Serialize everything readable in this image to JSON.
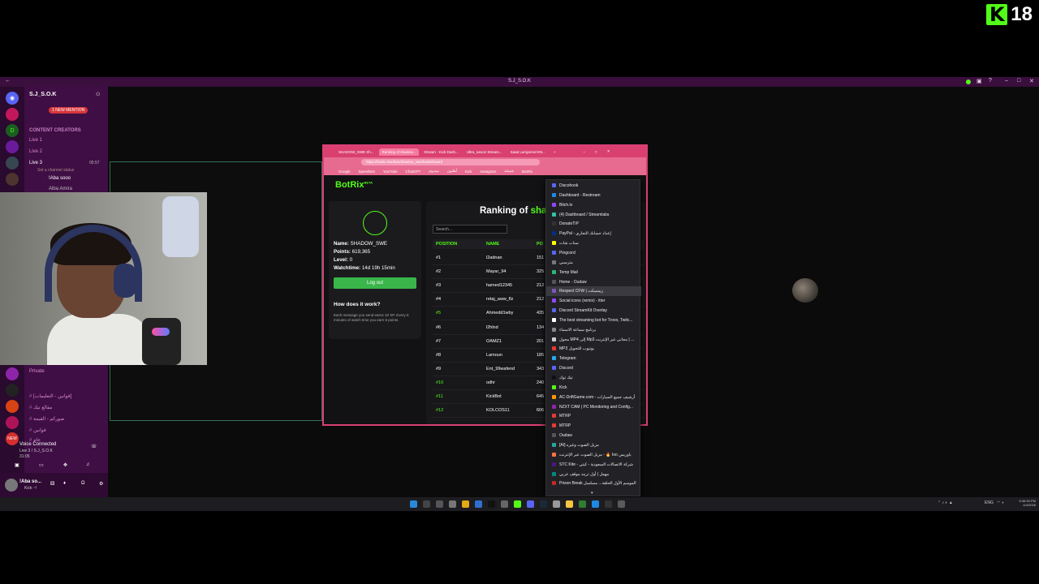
{
  "rating": {
    "logo_letter": "K",
    "age": "18"
  },
  "window": {
    "title": "S.J_S.O.K"
  },
  "discord": {
    "server_name": "S.J_S.O.K",
    "new_mention": "1 NEW MENTION",
    "category_creators": "CONTENT CREATORS",
    "channels": [
      {
        "label": "Live 1"
      },
      {
        "label": "Live 2"
      },
      {
        "label": "Live 3",
        "time": "05:57"
      },
      {
        "label": "Set a channel status"
      },
      {
        "label": "!Aba sooo"
      },
      {
        "label": "Alba Amira"
      },
      {
        "label": "Private"
      },
      {
        "label": "[قوانين - التعليمات]"
      },
      {
        "label": "مقالع تيك"
      },
      {
        "label": "صوركم - القيمة"
      },
      {
        "label": "قوانين"
      },
      {
        "label": "عام"
      }
    ],
    "voice_status": "Voice Connected",
    "voice_channel": "Live 3 / S.J_S.O.K",
    "voice_time": "31:05",
    "user": {
      "name": "!Aba so...",
      "status": "Kick ~!"
    }
  },
  "browser": {
    "tabs": [
      {
        "label": "SHADOW_SWE Sh..."
      },
      {
        "label": "Ranking of shadow..."
      },
      {
        "label": "Stream - Kick Dash..."
      },
      {
        "label": "Ultra_sano2 Stream..."
      },
      {
        "label": "Saad Lamjarred EN..."
      }
    ],
    "url": "https://botrix.live/kick/shadow_swe/leaderboard",
    "bookmarks": [
      "Google",
      "Speedtest",
      "YouTube",
      "ChatGPT",
      "ميديوم",
      "أهلنون",
      "Kick",
      "Instagram",
      "شيشة",
      "BotRix"
    ],
    "app": {
      "logo": "BotRix",
      "logo_badge": "BETA",
      "user": {
        "name_label": "Name:",
        "name": "SHADOW_SWE",
        "points_label": "Points:",
        "points": "619,365",
        "level_label": "Level:",
        "level": "0",
        "watch_label": "Watchtime:",
        "watchtime": "14d 19h 15min"
      },
      "logout": "Log out",
      "how_title": "How does it work?",
      "how_text": "Each message you send earns 10 XP. Every 6 minutes of watch time you earn 6 points.",
      "rank_title_prefix": "Ranking of ",
      "rank_title_name": "sha",
      "search_placeholder": "Search...",
      "columns": {
        "position": "POSITION",
        "name": "NAME",
        "points": "PO"
      },
      "rows": [
        {
          "pos": "#1",
          "name": "l2adnan",
          "pts": "151"
        },
        {
          "pos": "#2",
          "name": "Mayar_94",
          "pts": "325"
        },
        {
          "pos": "#3",
          "name": "hamed12345",
          "pts": "212"
        },
        {
          "pos": "#4",
          "name": "retaj_aww_flz",
          "pts": "212"
        },
        {
          "pos": "#5",
          "name": "Ahmedd1wby",
          "pts": "435"
        },
        {
          "pos": "#6",
          "name": "l2hlnd",
          "pts": "134"
        },
        {
          "pos": "#7",
          "name": "OAMZ1",
          "pts": "201"
        },
        {
          "pos": "#8",
          "name": "Lamoun",
          "pts": "185"
        },
        {
          "pos": "#9",
          "name": "Ent_99wafend",
          "pts": "343"
        },
        {
          "pos": "#10",
          "name": "odhr",
          "pts": "240"
        },
        {
          "pos": "#11",
          "name": "KickBot",
          "pts": "645"
        },
        {
          "pos": "#12",
          "name": "KOLCOS11",
          "pts": "606"
        }
      ]
    }
  },
  "bookmark_menu": {
    "items": [
      {
        "label": "Discohook",
        "color": "#5865f2"
      },
      {
        "label": "Dashboard - Restream",
        "color": "#1e88e5"
      },
      {
        "label": "Bitch.tv",
        "color": "#9146ff"
      },
      {
        "label": "(4) Dashboard / Streamlabs",
        "color": "#31c3a2"
      },
      {
        "label": "DonateTIP",
        "color": "#333333"
      },
      {
        "label": "PayPal - إعداد حسابك التجاري",
        "color": "#003087"
      },
      {
        "label": "سناب شات",
        "color": "#fffc00"
      },
      {
        "label": "Pingcord",
        "color": "#5865f2"
      },
      {
        "label": "مترسبي",
        "color": "#777777"
      },
      {
        "label": "Temp Mail",
        "color": "#2bb673"
      },
      {
        "label": "Home - Oudaw",
        "color": "#555555"
      },
      {
        "label": "Respect CFW | زيمسكت",
        "color": "#7e57c2"
      },
      {
        "label": "Social icons (remix) - itter",
        "color": "#9146ff"
      },
      {
        "label": "Discord StreamKit Overlay",
        "color": "#5865f2"
      },
      {
        "label": "The best streaming bot for Trovo, Twitc...",
        "color": "#ffffff"
      },
      {
        "label": "برنامج سماعة الاسماء",
        "color": "#888888"
      },
      {
        "label": "محول MP4 إلى Mp3 مجاني عبر الإنترنت | ...",
        "color": "#cccccc"
      },
      {
        "label": "MP3 يوتيوب للتحويل",
        "color": "#e53935"
      },
      {
        "label": "Telegram",
        "color": "#29a9eb"
      },
      {
        "label": "Discord",
        "color": "#5865f2"
      },
      {
        "label": "تيك توك",
        "color": "#111111"
      },
      {
        "label": "Kick",
        "color": "#53fc18"
      },
      {
        "label": "AC-DriftGame.com - أرشيف جميع السيارات",
        "color": "#ff9800"
      },
      {
        "label": "NZXT CAM | PC Monitoring and Config...",
        "color": "#8e24aa"
      },
      {
        "label": "MTRP",
        "color": "#e53935"
      },
      {
        "label": "MTRP",
        "color": "#e53935"
      },
      {
        "label": "Oudaw",
        "color": "#555555"
      },
      {
        "label": "[AI] مزيل الصوت وغيره",
        "color": "#26a69a"
      },
      {
        "label": "مزيل الصوت عبر الإنترنت - 🔥 Ioo باوريس",
        "color": "#ff7043"
      },
      {
        "label": "STC Kite - شركة الاتصالات السعودية - كيتي",
        "color": "#4a148c"
      },
      {
        "label": "مهمل | أول تريند موقف عربي",
        "color": "#00897b"
      },
      {
        "label": "Prison Break الموسم الأول الحلقة... مسلسل",
        "color": "#c62828"
      }
    ]
  },
  "taskbar": {
    "lang": "ENG",
    "time": "5:36:30 PM",
    "date": "4/4/2026"
  }
}
